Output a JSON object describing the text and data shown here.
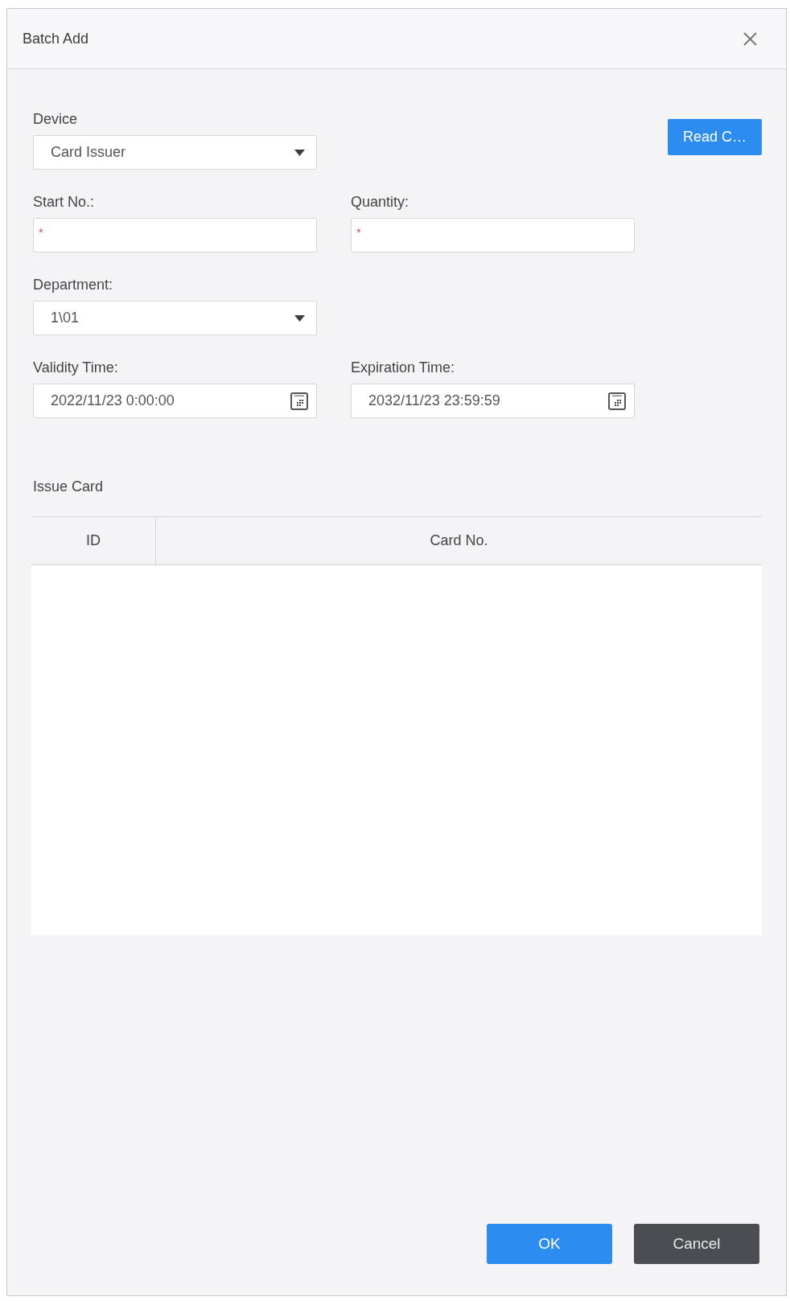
{
  "window": {
    "title": "Batch Add"
  },
  "form": {
    "rows": [
      [
        {
          "kind": "select",
          "label": "Device",
          "value": "Card Issuer"
        }
      ],
      [
        {
          "kind": "text",
          "label": "Start No.:",
          "required_mark": "*"
        },
        {
          "kind": "text",
          "label": "Quantity:",
          "required_mark": "*"
        }
      ],
      [
        {
          "kind": "select",
          "label": "Department:",
          "value": "1\\01"
        }
      ],
      [
        {
          "kind": "datetime",
          "label": "Validity Time:",
          "value": "2022/11/23 0:00:00"
        },
        {
          "kind": "datetime",
          "label": "Expiration Time:",
          "value": "2032/11/23 23:59:59"
        }
      ]
    ],
    "read_button": "Read C…"
  },
  "issue_card": {
    "title": "Issue Card",
    "table": {
      "columns": [
        "ID",
        "Card No."
      ]
    }
  },
  "buttons": [
    {
      "kind": "primary",
      "label": "OK"
    },
    {
      "kind": "secondary",
      "label": "Cancel"
    }
  ]
}
